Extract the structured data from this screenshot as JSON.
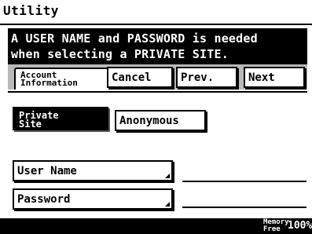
{
  "window": {
    "title": "Utility"
  },
  "message": {
    "line1": "A USER NAME and PASSWORD is needed",
    "line2": "when selecting a PRIVATE SITE."
  },
  "tabs": {
    "account_line1": "Account",
    "account_line2": "Information"
  },
  "nav": {
    "cancel_label": "Cancel",
    "prev_label": "Prev.",
    "next_label": "Next"
  },
  "site_type": {
    "private_line1": "Private",
    "private_line2": "Site",
    "anonymous_label": "Anonymous",
    "selected": "Private Site"
  },
  "fields": {
    "username_label": "User Name",
    "username_value": "",
    "password_label": "Password",
    "password_value": ""
  },
  "status": {
    "memory_line1": "Memory",
    "memory_line2": "Free",
    "memory_value": "100%"
  }
}
